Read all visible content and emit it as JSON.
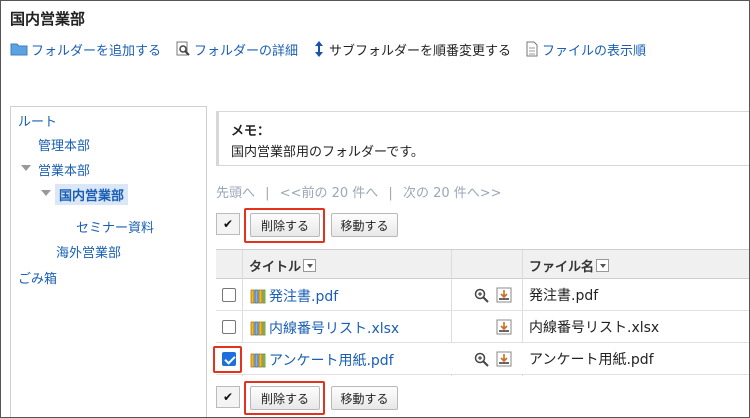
{
  "page": {
    "title": "国内営業部"
  },
  "toolbar": [
    {
      "label": "フォルダーを追加する",
      "icon": "folder-icon"
    },
    {
      "label": "フォルダーの詳細",
      "icon": "folder-detail-icon"
    },
    {
      "label": "サブフォルダーを順番変更する",
      "icon": "reorder-icon"
    },
    {
      "label": "ファイルの表示順",
      "icon": "file-order-icon"
    }
  ],
  "sidebar": {
    "items": [
      {
        "label": "ルート"
      },
      {
        "label": "管理本部"
      },
      {
        "label": "営業本部"
      },
      {
        "label": "国内営業部",
        "selected": true
      },
      {
        "label": "セミナー資料"
      },
      {
        "label": "海外営業部"
      },
      {
        "label": "ごみ箱"
      }
    ]
  },
  "memo": {
    "label": "メモ：",
    "body": "国内営業部用のフォルダーです。"
  },
  "pager": {
    "first": "先頭へ",
    "sep1": "|",
    "prev": "<<前の 20 件へ",
    "sep2": "|",
    "next": "次の 20 件へ>>"
  },
  "actions": {
    "checkall": "✔",
    "delete": "削除する",
    "move": "移動する"
  },
  "table": {
    "headers": {
      "title": "タイトル",
      "filename": "ファイル名"
    },
    "rows": [
      {
        "title": "発注書.pdf",
        "filename": "発注書.pdf",
        "checked": false,
        "has_zoom": true
      },
      {
        "title": "内線番号リスト.xlsx",
        "filename": "内線番号リスト.xlsx",
        "checked": false,
        "has_zoom": false
      },
      {
        "title": "アンケート用紙.pdf",
        "filename": "アンケート用紙.pdf",
        "checked": true,
        "has_zoom": true
      }
    ]
  },
  "colors": {
    "link": "#1a5fb4",
    "highlight": "#e3331f",
    "checkbox_checked": "#1d6fe0"
  }
}
